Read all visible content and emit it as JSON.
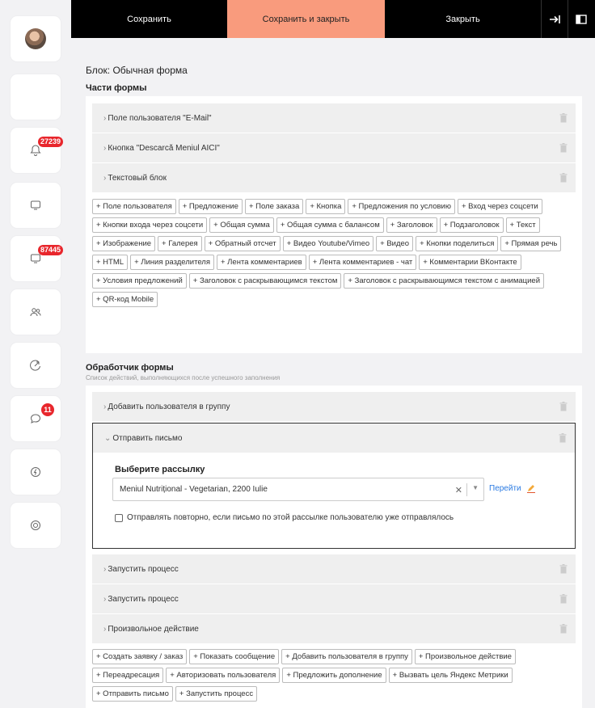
{
  "toolbar": {
    "save": "Сохранить",
    "save_close": "Сохранить и закрыть",
    "close": "Закрыть"
  },
  "sidebar": {
    "notifications_badge": "27239",
    "chat_badge": "87445",
    "messages_badge": "11"
  },
  "block_title": "Блок: Обычная форма",
  "form_parts": {
    "label": "Части формы",
    "rows": [
      "Поле пользователя \"E-Mail\"",
      "Кнопка \"Descarcă Meniul AICI\"",
      "Текстовый блок"
    ],
    "chips": [
      "+ Поле пользователя",
      "+ Предложение",
      "+ Поле заказа",
      "+ Кнопка",
      "+ Предложения по условию",
      "+ Вход через соцсети",
      "+ Кнопки входа через соцсети",
      "+ Общая сумма",
      "+ Общая сумма с балансом",
      "+ Заголовок",
      "+ Подзаголовок",
      "+ Текст",
      "+ Изображение",
      "+ Галерея",
      "+ Обратный отсчет",
      "+ Видео Youtube/Vimeo",
      "+ Видео",
      "+ Кнопки поделиться",
      "+ Прямая речь",
      "+ HTML",
      "+ Линия разделителя",
      "+ Лента комментариев",
      "+ Лента комментариев - чат",
      "+ Комментарии ВКонтакте",
      "+ Условия предложений",
      "+ Заголовок с раскрывающимся текстом",
      "+ Заголовок с раскрывающимся текстом с анимацией",
      "+ QR-код Mobile"
    ]
  },
  "handler": {
    "label": "Обработчик формы",
    "subtitle": "Список действий, выполняющихся после успешного заполнения",
    "row_add_group": "Добавить пользователя в группу",
    "expanded_title": "Отправить письмо",
    "select_label": "Выберите рассылку",
    "select_value": "Meniul Nutrițional - Vegetarian, 2200 Iulie",
    "go_link": "Перейти",
    "resend_label": "Отправлять повторно, если письмо по этой рассылке пользователю уже отправлялось",
    "rows_after": [
      "Запустить процесс",
      "Запустить процесс",
      "Произвольное действие"
    ],
    "chips": [
      "+ Создать заявку / заказ",
      "+ Показать сообщение",
      "+ Добавить пользователя в группу",
      "+ Произвольное действие",
      "+ Переадресация",
      "+ Авторизовать пользователя",
      "+ Предложить дополнение",
      "+ Вызвать цель Яндекс Метрики",
      "+ Отправить письмо",
      "+ Запустить процесс"
    ]
  }
}
